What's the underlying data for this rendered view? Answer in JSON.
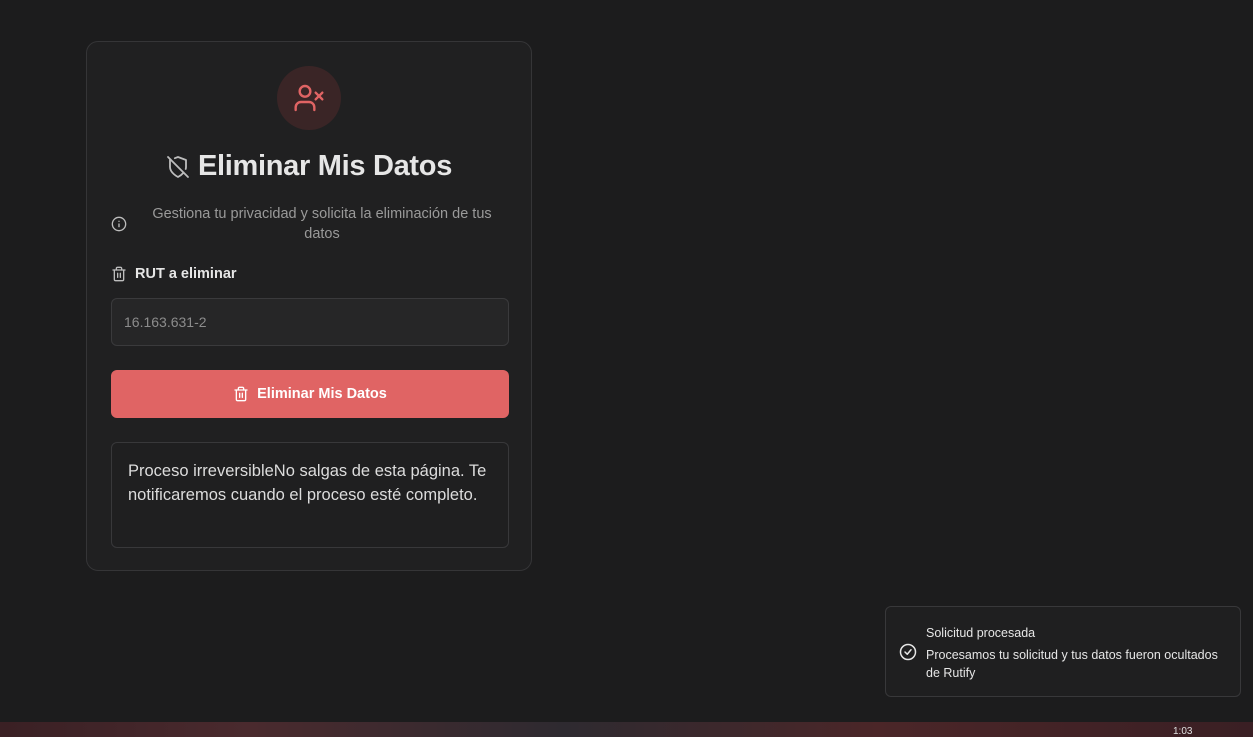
{
  "card": {
    "title": "Eliminar Mis Datos",
    "subtitle": "Gestiona tu privacidad y solicita la eliminación de tus datos",
    "field_label": "RUT a eliminar",
    "rut_placeholder": "16.163.631-2",
    "button_label": "Eliminar Mis Datos",
    "notice": "Proceso irreversibleNo salgas de esta página. Te notificaremos cuando el proceso esté completo."
  },
  "toast": {
    "title": "Solicitud procesada",
    "description": "Procesamos tu solicitud y tus datos fueron ocultados de Rutify"
  },
  "taskbar": {
    "clock": "1:03"
  },
  "colors": {
    "accent": "#e06464",
    "background": "#1c1c1d",
    "card": "#202021"
  },
  "icons": {
    "avatar": "user-x-icon",
    "title": "shield-off-icon",
    "subtitle": "info-icon",
    "field": "trash-icon",
    "button": "trash-icon",
    "toast": "check-circle-icon"
  }
}
